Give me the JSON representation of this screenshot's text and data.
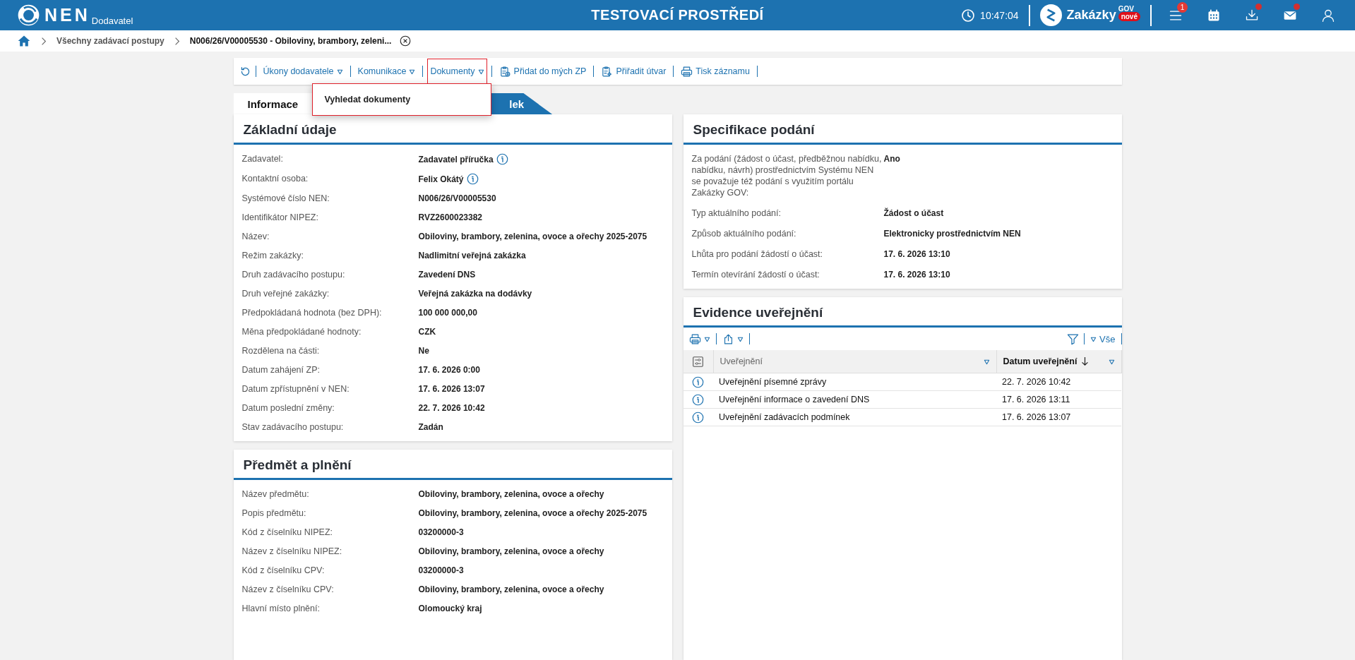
{
  "header": {
    "logo": "NEN",
    "logo_sub": "Dodavatel",
    "environment": "TESTOVACÍ PROSTŘEDÍ",
    "clock": "10:47:04",
    "brand": {
      "name": "Zakázky",
      "sup": "GOV",
      "badge": "nové"
    },
    "icons": [
      {
        "kind": "menu",
        "badge": "1",
        "dot": false
      },
      {
        "kind": "calendar",
        "dot": false
      },
      {
        "kind": "download",
        "dot": true
      },
      {
        "kind": "mail",
        "dot": true
      },
      {
        "kind": "user",
        "dot": false
      }
    ]
  },
  "breadcrumb": [
    {
      "label": "Všechny zadávací postupy",
      "current": false
    },
    {
      "label": "N006/26/V00005530 - Obiloviny, brambory, zeleni...",
      "current": true
    }
  ],
  "toolbar": [
    {
      "kind": "refresh"
    },
    {
      "kind": "dropdown",
      "label": "Úkony dodavatele",
      "open": false
    },
    {
      "kind": "dropdown",
      "label": "Komunikace",
      "open": false
    },
    {
      "kind": "dropdown",
      "label": "Dokumenty",
      "open": true
    },
    {
      "kind": "add",
      "label": "Přidat do mých ZP"
    },
    {
      "kind": "assign",
      "label": "Přiřadit útvar"
    },
    {
      "kind": "print",
      "label": "Tisk záznamu"
    }
  ],
  "dropdown_menu": [
    "Vyhledat dokumenty"
  ],
  "tabs": [
    {
      "label": "Informace",
      "selected": true
    },
    {
      "label": "lek",
      "selected": false
    }
  ],
  "left_panels": [
    {
      "title": "Základní údaje",
      "rows": [
        {
          "label": "Zadavatel:",
          "value": "Zadavatel příručka",
          "info": true
        },
        {
          "label": "Kontaktní osoba:",
          "value": "Felix Okátý",
          "info": true
        },
        {
          "label": "Systémové číslo NEN:",
          "value": "N006/26/V00005530",
          "info": false
        },
        {
          "label": "Identifikátor NIPEZ:",
          "value": "RVZ2600023382",
          "info": false
        },
        {
          "label": "Název:",
          "value": "Obiloviny, brambory, zelenina, ovoce a ořechy 2025-2075",
          "info": false
        },
        {
          "label": "Režim zakázky:",
          "value": "Nadlimitní veřejná zakázka",
          "info": false
        },
        {
          "label": "Druh zadávacího postupu:",
          "value": "Zavedení DNS",
          "info": false
        },
        {
          "label": "Druh veřejné zakázky:",
          "value": "Veřejná zakázka na dodávky",
          "info": false
        },
        {
          "label": "Předpokládaná hodnota (bez DPH):",
          "value": "100 000 000,00",
          "info": false
        },
        {
          "label": "Měna předpokládané hodnoty:",
          "value": "CZK",
          "info": false
        },
        {
          "label": "Rozdělena na části:",
          "value": "Ne",
          "info": false
        },
        {
          "label": "Datum zahájení ZP:",
          "value": "17. 6. 2026 0:00",
          "info": false
        },
        {
          "label": "Datum zpřístupnění v NEN:",
          "value": "17. 6. 2026 13:07",
          "info": false
        },
        {
          "label": "Datum poslední změny:",
          "value": "22. 7. 2026 10:42",
          "info": false
        },
        {
          "label": "Stav zadávacího postupu:",
          "value": "Zadán",
          "info": false
        }
      ]
    },
    {
      "title": "Předmět a plnění",
      "rows": [
        {
          "label": "Název předmětu:",
          "value": "Obiloviny, brambory, zelenina, ovoce a ořechy",
          "info": false
        },
        {
          "label": "Popis předmětu:",
          "value": "Obiloviny, brambory, zelenina, ovoce a ořechy 2025-2075",
          "info": false
        },
        {
          "label": "Kód z číselníku NIPEZ:",
          "value": "03200000-3",
          "info": false
        },
        {
          "label": "Název z číselníku NIPEZ:",
          "value": "Obiloviny, brambory, zelenina, ovoce a ořechy",
          "info": false
        },
        {
          "label": "Kód z číselníku CPV:",
          "value": "03200000-3",
          "info": false
        },
        {
          "label": "Název z číselníku CPV:",
          "value": "Obiloviny, brambory, zelenina, ovoce a ořechy",
          "info": false
        },
        {
          "label": "Hlavní místo plnění:",
          "value": "Olomoucký kraj",
          "info": false
        }
      ]
    }
  ],
  "specification": {
    "title": "Specifikace podání",
    "rows": [
      {
        "label": "Za podání (žádost o účast, předběžnou nabídku, nabídku, návrh) prostřednictvím Systému NEN se považuje též podání s využitím portálu Zakázky GOV:",
        "value": "Ano"
      },
      {
        "label": "Typ aktuálního podání:",
        "value": "Žádost o účast"
      },
      {
        "label": "Způsob aktuálního podání:",
        "value": "Elektronicky prostřednictvím NEN"
      },
      {
        "label": "Lhůta pro podání žádostí o účast:",
        "value": "17. 6. 2026 13:10"
      },
      {
        "label": "Termín otevírání žádostí o účast:",
        "value": "17. 6. 2026 13:10"
      }
    ]
  },
  "publications": {
    "title": "Evidence uveřejnění",
    "filter_label": "Vše",
    "columns": [
      {
        "label": "Uveřejnění",
        "sorted": false
      },
      {
        "label": "Datum uveřejnění",
        "sorted": true
      }
    ],
    "rows": [
      {
        "name": "Uveřejnění písemné zprávy",
        "date": "22. 7. 2026 10:42"
      },
      {
        "name": "Uveřejnění informace o zavedení DNS",
        "date": "17. 6. 2026 13:11"
      },
      {
        "name": "Uveřejnění zadávacích podmínek",
        "date": "17. 6. 2026 13:07"
      }
    ]
  }
}
